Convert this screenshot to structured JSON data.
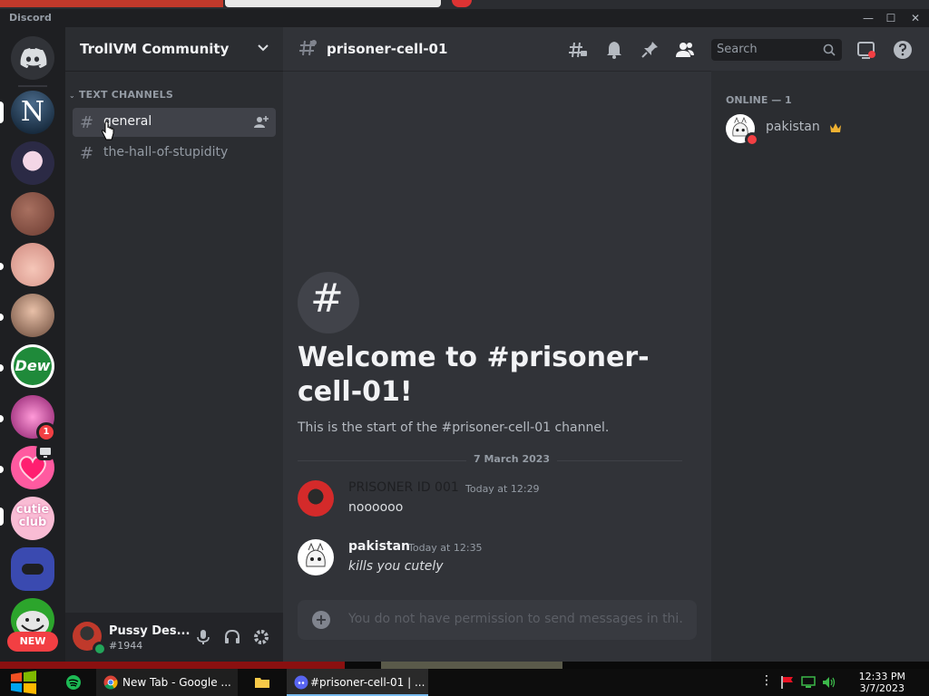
{
  "app": {
    "title": "Discord"
  },
  "window": {
    "minimize": "—",
    "maximize": "☐",
    "close": "✕"
  },
  "guild": {
    "name": "TrollVM Community"
  },
  "rail": {
    "servers": [
      {
        "name": "n-server",
        "bg": "#0a2a3a",
        "glyph": "N"
      },
      {
        "name": "anime-server",
        "bg": "#3b3a5a",
        "glyph": ""
      },
      {
        "name": "server-3",
        "bg": "#8a5a4a",
        "glyph": ""
      },
      {
        "name": "server-4",
        "bg": "#e8b0a0",
        "glyph": ""
      },
      {
        "name": "server-5",
        "bg": "#c09080",
        "glyph": ""
      },
      {
        "name": "mtn-dew-server",
        "bg": "#1f8a3a",
        "glyph": "Dew"
      },
      {
        "name": "kitty-server",
        "bg": "#c02a8a",
        "glyph": ""
      },
      {
        "name": "heart-server",
        "bg": "#ff5a9a",
        "glyph": ""
      },
      {
        "name": "cutie-club-server",
        "bg": "#f7a8c8",
        "glyph": "cutie club"
      },
      {
        "name": "server-10",
        "bg": "#3a4ab0",
        "glyph": ""
      },
      {
        "name": "trollface-server",
        "bg": "#2aa52a",
        "glyph": ""
      }
    ],
    "badge_count": "1",
    "new_label": "NEW"
  },
  "sidebar": {
    "category": "TEXT CHANNELS",
    "channels": [
      {
        "hash": "#",
        "label": "general"
      },
      {
        "hash": "#",
        "label": "the-hall-of-stupidity"
      }
    ]
  },
  "user": {
    "name": "Pussy Des...",
    "tag": "#1944"
  },
  "toolbar": {
    "hash": "#",
    "channel": "prisoner-cell-01",
    "search_placeholder": "Search"
  },
  "welcome": {
    "title": "Welcome to #prisoner-cell-01!",
    "subtitle": "This is the start of the #prisoner-cell-01 channel.",
    "hash": "#"
  },
  "date_divider": "7 March 2023",
  "messages": [
    {
      "author": "PRISONER ID 001",
      "time": "Today at 12:29",
      "body": "noooooo"
    },
    {
      "author": "pakistan",
      "time": "Today at 12:35",
      "body": "kills you cutely"
    }
  ],
  "composer": {
    "placeholder": "You do not have permission to send messages in thi...",
    "plus": "+"
  },
  "members": {
    "header": "ONLINE — 1",
    "list": [
      {
        "name": "pakistan"
      }
    ]
  },
  "taskbar": {
    "chrome_label": "New Tab - Google ...",
    "discord_label": "#prisoner-cell-01 | ...",
    "time": "12:33 PM",
    "date": "3/7/2023"
  },
  "colors": {
    "accent": "#5865f2",
    "online": "#23a55a",
    "dnd": "#f23f43",
    "author1": "#1e1f22"
  }
}
